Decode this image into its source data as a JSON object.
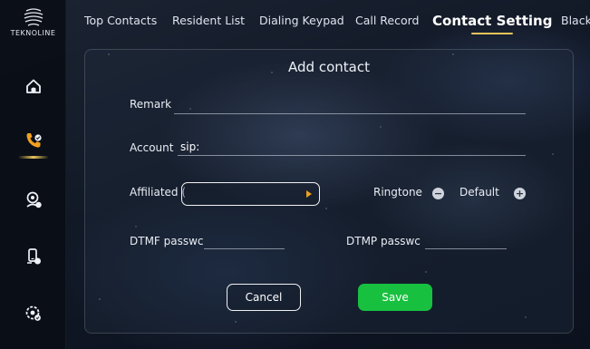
{
  "brand": {
    "logo_text": "TEKNOLINE"
  },
  "sidebar": {
    "items": [
      {
        "icon": "home-icon",
        "active": false
      },
      {
        "icon": "phone-icon",
        "active": true
      },
      {
        "icon": "monitor-user-icon",
        "active": false
      },
      {
        "icon": "phone-lock-icon",
        "active": false
      },
      {
        "icon": "settings-icon",
        "active": false
      }
    ],
    "accent_color": "#e8c45a"
  },
  "tabs": [
    {
      "label": "Top Contacts",
      "active": false
    },
    {
      "label": "Resident List",
      "active": false
    },
    {
      "label": "Dialing Keypad",
      "active": false
    },
    {
      "label": "Call Record",
      "active": false
    },
    {
      "label": "Contact Setting",
      "active": true
    },
    {
      "label": "Black",
      "active": false
    }
  ],
  "dialog": {
    "title": "Add contact",
    "remark": {
      "label": "Remark",
      "value": ""
    },
    "account": {
      "label": "Account",
      "prefix": "sip:",
      "value": ""
    },
    "affiliated": {
      "label": "Affiliated (",
      "value": ""
    },
    "ringtone": {
      "label": "Ringtone",
      "value": "Default",
      "minus": "−",
      "plus": "+"
    },
    "dtmf_password": {
      "label": "DTMF passwc",
      "value": ""
    },
    "dtmp_password": {
      "label": "DTMP passwc",
      "value": ""
    },
    "cancel_label": "Cancel",
    "save_label": "Save",
    "save_color": "#18c040"
  }
}
